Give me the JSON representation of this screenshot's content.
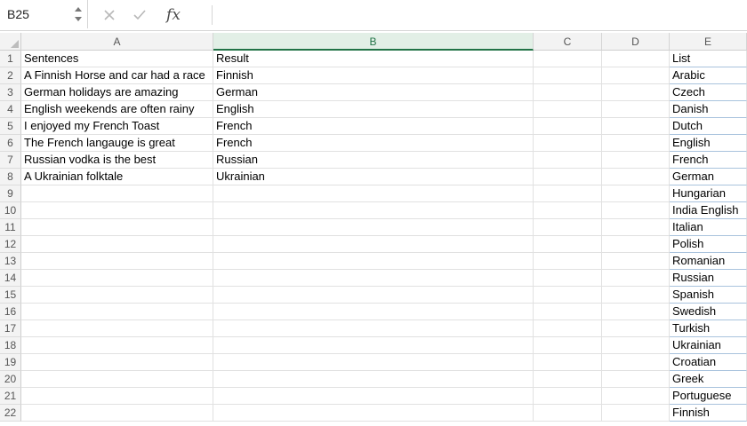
{
  "formula_bar": {
    "name_box": "B25",
    "cancel_icon": "x-icon",
    "confirm_icon": "check-icon",
    "function_label": "fx",
    "formula_value": ""
  },
  "columns": [
    "A",
    "B",
    "C",
    "D",
    "E"
  ],
  "selected_column": "B",
  "rows": [
    {
      "n": "1",
      "A": "Sentences",
      "B": "Result",
      "E": "List"
    },
    {
      "n": "2",
      "A": "A Finnish Horse and car had a race",
      "B": "Finnish",
      "E": "Arabic"
    },
    {
      "n": "3",
      "A": "German holidays are amazing",
      "B": "German",
      "E": "Czech"
    },
    {
      "n": "4",
      "A": "English weekends are often rainy",
      "B": "English",
      "E": "Danish"
    },
    {
      "n": "5",
      "A": "I enjoyed my French Toast",
      "B": "French",
      "E": "Dutch"
    },
    {
      "n": "6",
      "A": "The French langauge is great",
      "B": "French",
      "E": "English"
    },
    {
      "n": "7",
      "A": "Russian vodka is the best",
      "B": "Russian",
      "E": "French"
    },
    {
      "n": "8",
      "A": "A Ukrainian folktale",
      "B": "Ukrainian",
      "E": "German"
    },
    {
      "n": "9",
      "A": "",
      "B": "",
      "E": "Hungarian"
    },
    {
      "n": "10",
      "A": "",
      "B": "",
      "E": "India English"
    },
    {
      "n": "11",
      "A": "",
      "B": "",
      "E": "Italian"
    },
    {
      "n": "12",
      "A": "",
      "B": "",
      "E": "Polish"
    },
    {
      "n": "13",
      "A": "",
      "B": "",
      "E": "Romanian"
    },
    {
      "n": "14",
      "A": "",
      "B": "",
      "E": "Russian"
    },
    {
      "n": "15",
      "A": "",
      "B": "",
      "E": "Spanish"
    },
    {
      "n": "16",
      "A": "",
      "B": "",
      "E": "Swedish"
    },
    {
      "n": "17",
      "A": "",
      "B": "",
      "E": "Turkish"
    },
    {
      "n": "18",
      "A": "",
      "B": "",
      "E": "Ukrainian"
    },
    {
      "n": "19",
      "A": "",
      "B": "",
      "E": "Croatian"
    },
    {
      "n": "20",
      "A": "",
      "B": "",
      "E": "Greek"
    },
    {
      "n": "21",
      "A": "",
      "B": "",
      "E": "Portuguese"
    },
    {
      "n": "22",
      "A": "",
      "B": "",
      "E": "Finnish"
    }
  ],
  "colors": {
    "header_bg": "#f3f3f3",
    "selected_header_accent": "#217346",
    "gridline": "#e1e1e1",
    "list_border": "#a9c3dd"
  }
}
